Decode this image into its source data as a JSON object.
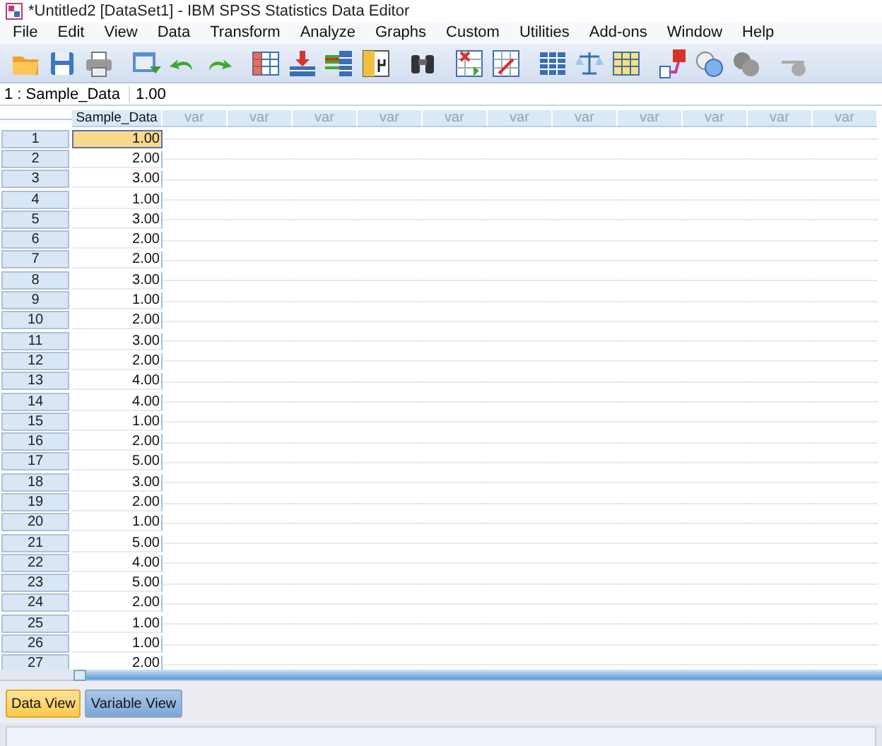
{
  "window": {
    "title": "*Untitled2 [DataSet1] - IBM SPSS Statistics Data Editor"
  },
  "menu": [
    "File",
    "Edit",
    "View",
    "Data",
    "Transform",
    "Analyze",
    "Graphs",
    "Custom",
    "Utilities",
    "Add-ons",
    "Window",
    "Help"
  ],
  "cell_ref": {
    "name": "1 : Sample_Data",
    "value": "1.00"
  },
  "table": {
    "columns": [
      "Sample_Data",
      "var",
      "var",
      "var",
      "var",
      "var",
      "var",
      "var",
      "var",
      "var",
      "var",
      "var"
    ],
    "rows": [
      {
        "number": "1",
        "value": "1.00",
        "selected": true
      },
      {
        "number": "2",
        "value": "2.00",
        "selected": false
      },
      {
        "number": "3",
        "value": "3.00",
        "selected": false
      },
      {
        "number": "4",
        "value": "1.00",
        "selected": false
      },
      {
        "number": "5",
        "value": "3.00",
        "selected": false
      },
      {
        "number": "6",
        "value": "2.00",
        "selected": false
      },
      {
        "number": "7",
        "value": "2.00",
        "selected": false
      },
      {
        "number": "8",
        "value": "3.00",
        "selected": false
      },
      {
        "number": "9",
        "value": "1.00",
        "selected": false
      },
      {
        "number": "10",
        "value": "2.00",
        "selected": false
      },
      {
        "number": "11",
        "value": "3.00",
        "selected": false
      },
      {
        "number": "12",
        "value": "2.00",
        "selected": false
      },
      {
        "number": "13",
        "value": "4.00",
        "selected": false
      },
      {
        "number": "14",
        "value": "4.00",
        "selected": false
      },
      {
        "number": "15",
        "value": "1.00",
        "selected": false
      },
      {
        "number": "16",
        "value": "2.00",
        "selected": false
      },
      {
        "number": "17",
        "value": "5.00",
        "selected": false
      },
      {
        "number": "18",
        "value": "3.00",
        "selected": false
      },
      {
        "number": "19",
        "value": "2.00",
        "selected": false
      },
      {
        "number": "20",
        "value": "1.00",
        "selected": false
      },
      {
        "number": "21",
        "value": "5.00",
        "selected": false
      },
      {
        "number": "22",
        "value": "4.00",
        "selected": false
      },
      {
        "number": "23",
        "value": "5.00",
        "selected": false
      },
      {
        "number": "24",
        "value": "2.00",
        "selected": false
      },
      {
        "number": "25",
        "value": "1.00",
        "selected": false
      },
      {
        "number": "26",
        "value": "1.00",
        "selected": false
      },
      {
        "number": "27",
        "value": "2.00",
        "selected": false
      }
    ]
  },
  "tabs": [
    {
      "label": "Data View",
      "selected": true
    },
    {
      "label": "Variable View",
      "selected": false
    }
  ]
}
